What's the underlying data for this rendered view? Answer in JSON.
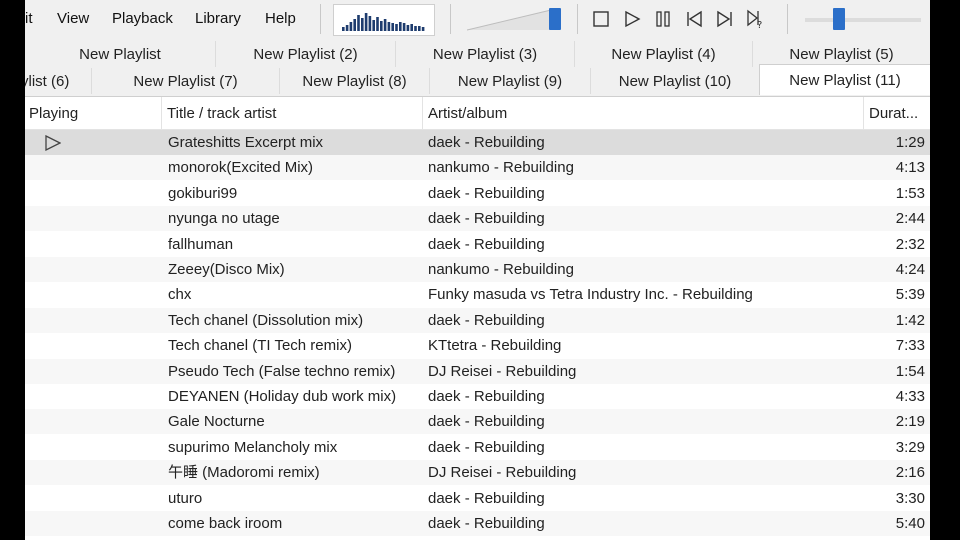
{
  "menu": {
    "items": [
      "it",
      "View",
      "Playback",
      "Library",
      "Help"
    ]
  },
  "toolbar": {
    "seekbar_fraction": 0.95,
    "volume_fraction": 0.27,
    "buttons": [
      "stop-icon",
      "play-icon",
      "pause-icon",
      "previous-icon",
      "next-icon",
      "random-icon"
    ]
  },
  "tabs": {
    "row1": [
      "New Playlist",
      "New Playlist (2)",
      "New Playlist (3)",
      "New Playlist (4)",
      "New Playlist (5)"
    ],
    "row2": [
      "ylist (6)",
      "New Playlist (7)",
      "New Playlist (8)",
      "New Playlist (9)",
      "New Playlist (10)",
      "New Playlist (11)"
    ],
    "active": "New Playlist (11)"
  },
  "columns": {
    "playing": "Playing",
    "title": "Title / track artist",
    "artist": "Artist/album",
    "duration": "Durat..."
  },
  "tracks": [
    {
      "title": "Grateshitts Excerpt mix",
      "artist": "daek - Rebuilding",
      "duration": "1:29",
      "playing": true
    },
    {
      "title": "monorok(Excited Mix)",
      "artist": "nankumo - Rebuilding",
      "duration": "4:13"
    },
    {
      "title": "gokiburi99",
      "artist": "daek - Rebuilding",
      "duration": "1:53"
    },
    {
      "title": "nyunga no utage",
      "artist": "daek - Rebuilding",
      "duration": "2:44"
    },
    {
      "title": "fallhuman",
      "artist": "daek - Rebuilding",
      "duration": "2:32"
    },
    {
      "title": "Zeeey(Disco Mix)",
      "artist": "nankumo - Rebuilding",
      "duration": "4:24"
    },
    {
      "title": "chx",
      "artist": "Funky masuda vs Tetra Industry Inc. - Rebuilding",
      "duration": "5:39"
    },
    {
      "title": "Tech chanel (Dissolution mix)",
      "artist": "daek - Rebuilding",
      "duration": "1:42"
    },
    {
      "title": "Tech chanel (TI Tech remix)",
      "artist": "KTtetra - Rebuilding",
      "duration": "7:33"
    },
    {
      "title": "Pseudo Tech (False techno remix)",
      "artist": "DJ Reisei - Rebuilding",
      "duration": "1:54"
    },
    {
      "title": "DEYANEN (Holiday dub work mix)",
      "artist": "daek - Rebuilding",
      "duration": "4:33"
    },
    {
      "title": "Gale Nocturne",
      "artist": "daek - Rebuilding",
      "duration": "2:19"
    },
    {
      "title": "supurimo Melancholy mix",
      "artist": "daek - Rebuilding",
      "duration": "3:29"
    },
    {
      "title": "午睡 (Madoromi remix)",
      "artist": "DJ Reisei - Rebuilding",
      "duration": "2:16"
    },
    {
      "title": "uturo",
      "artist": "daek - Rebuilding",
      "duration": "3:30"
    },
    {
      "title": "come back iroom",
      "artist": "daek - Rebuilding",
      "duration": "5:40"
    }
  ],
  "colors": {
    "accent": "#2b6fc9",
    "selected_row": "#dcdcdc"
  }
}
